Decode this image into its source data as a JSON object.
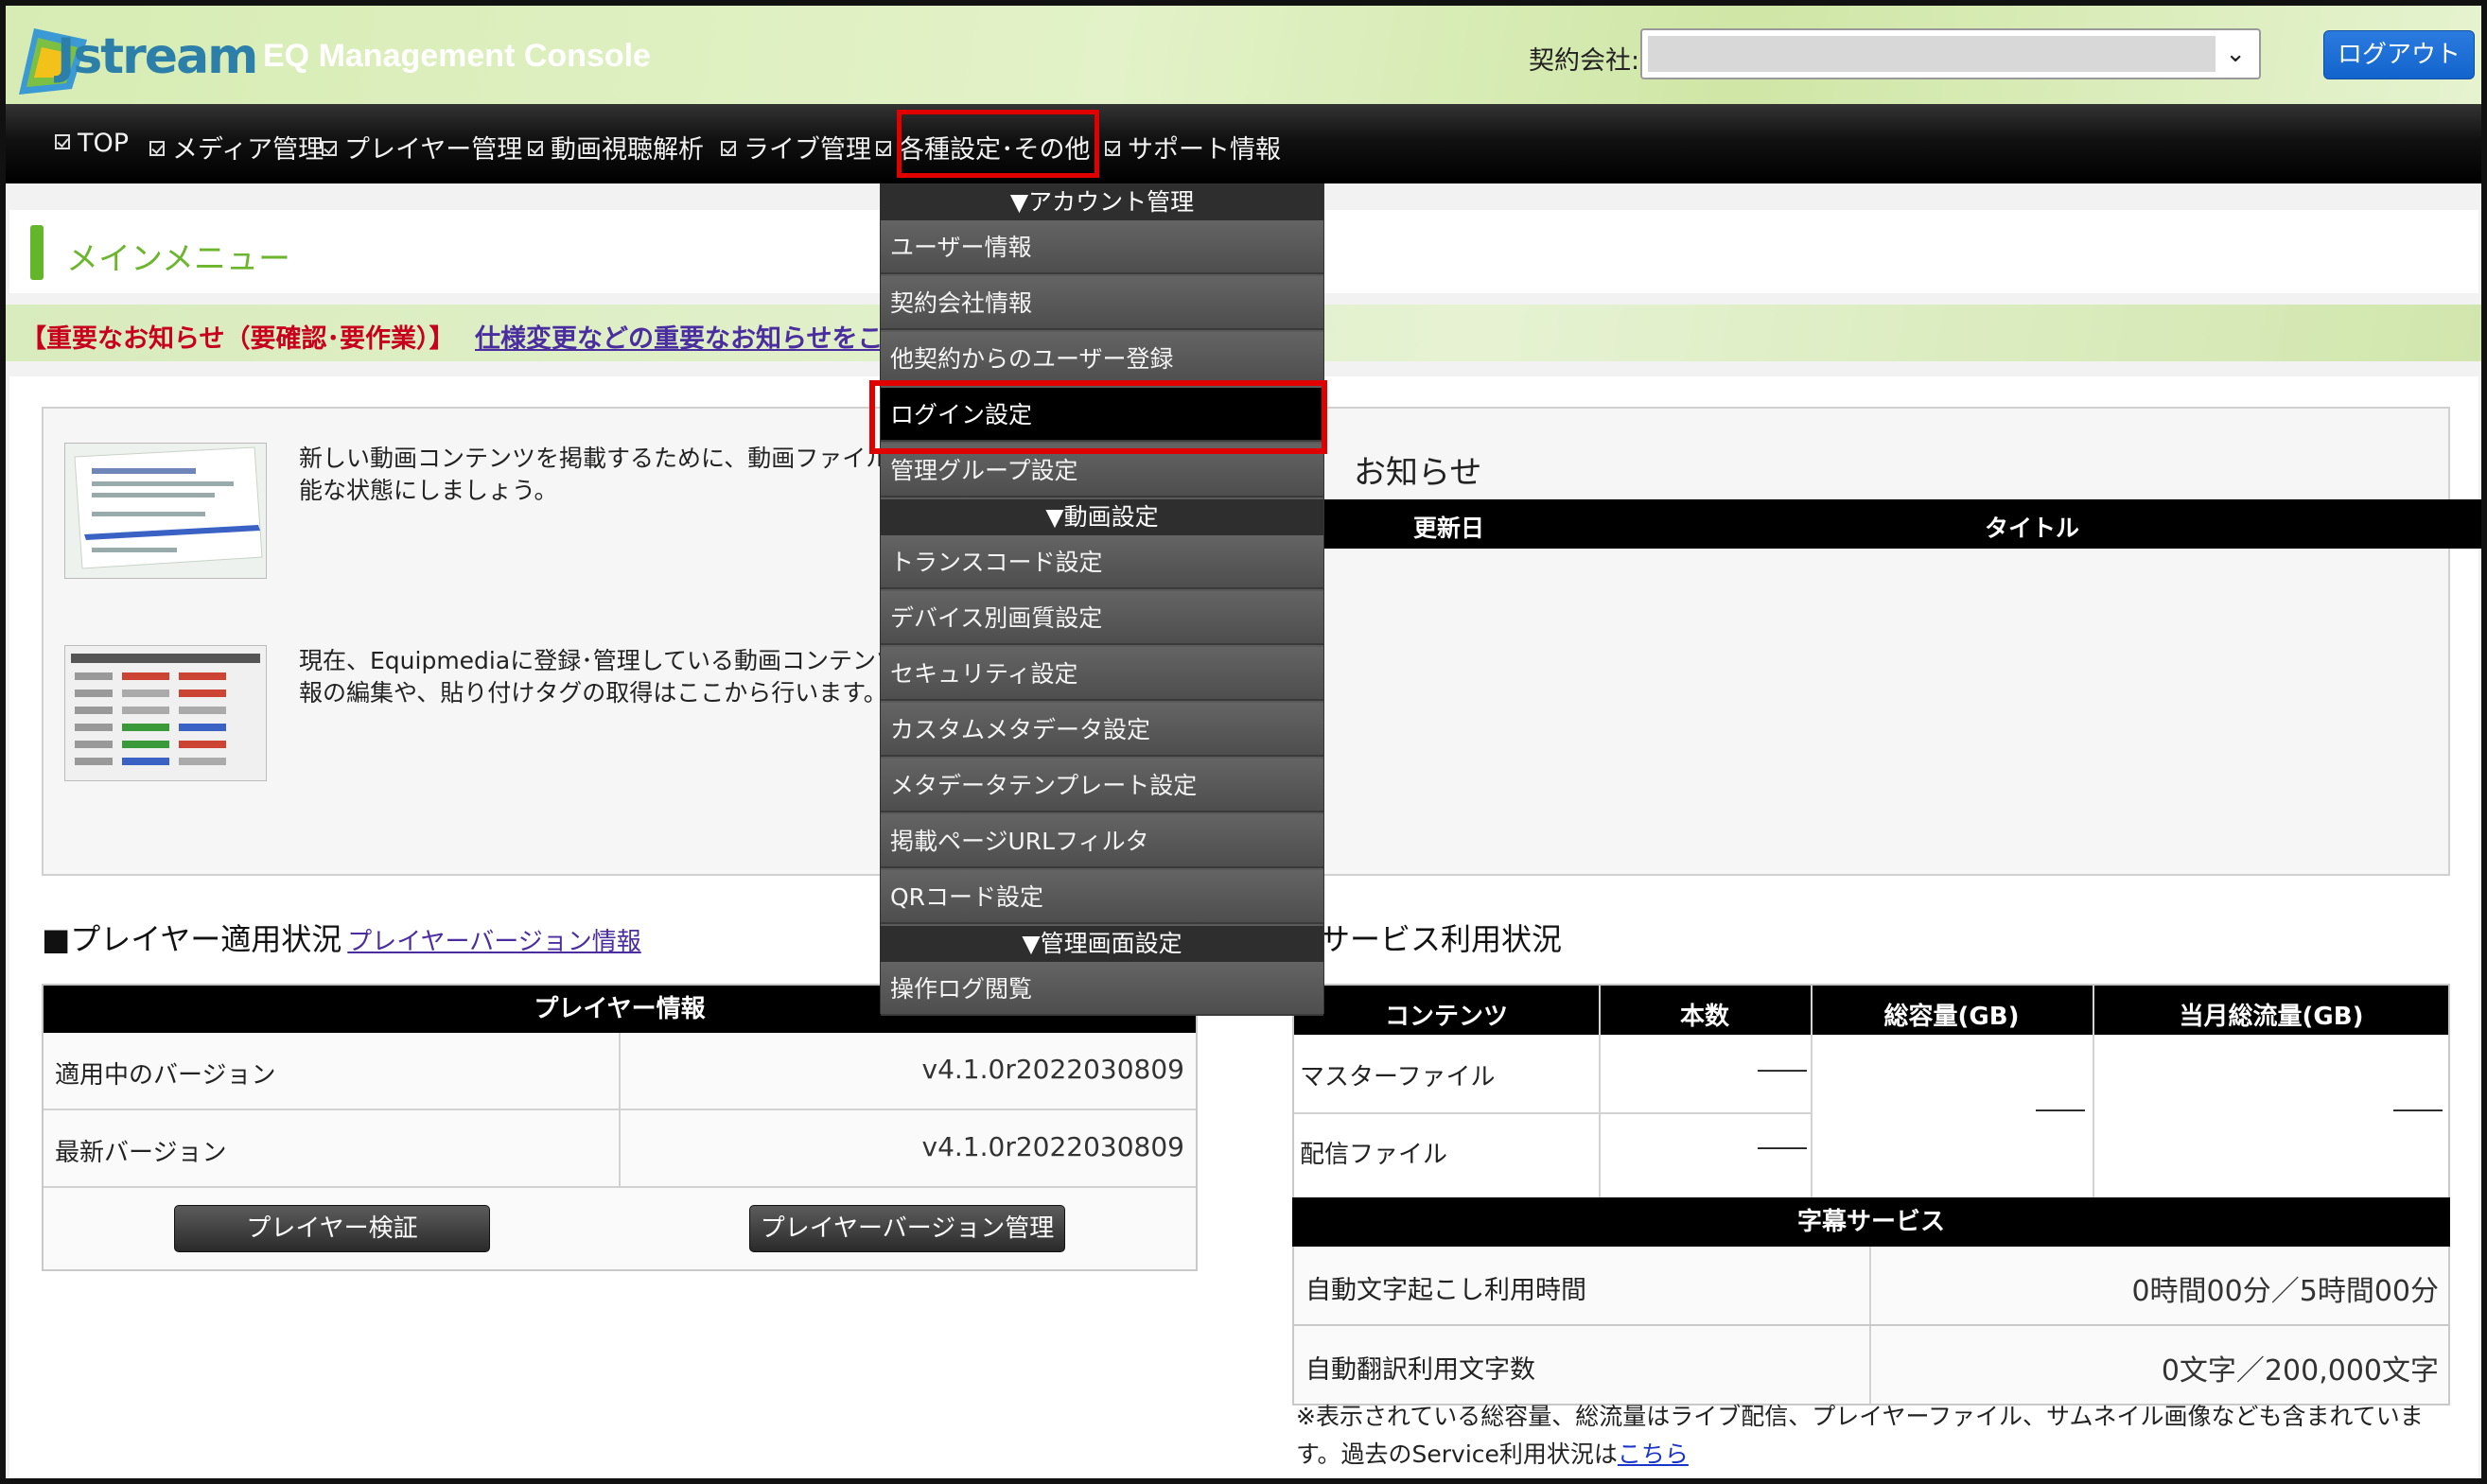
{
  "header": {
    "logo_text": "Jstream",
    "app_title": "EQ Management Console",
    "contract_label": "契約会社:",
    "contract_value": "",
    "logout_label": "ログアウト"
  },
  "nav": {
    "items": [
      {
        "label": "TOP"
      },
      {
        "label": "メディア管理"
      },
      {
        "label": "プレイヤー管理"
      },
      {
        "label": "動画視聴解析"
      },
      {
        "label": "ライブ管理"
      },
      {
        "label": "各種設定･その他"
      },
      {
        "label": "サポート情報"
      }
    ]
  },
  "main": {
    "section_title": "メインメニュー",
    "important_notice": "【重要なお知らせ（要確認･要作業）】",
    "notice_link": "仕様変更などの重要なお知らせをこ",
    "media": [
      {
        "text_line1": "新しい動画コンテンツを掲載するために、動画ファイルを",
        "text_line2": "能な状態にしましょう。"
      },
      {
        "text_line1": "現在、Equipmediaに登録･管理している動画コンテンツの",
        "text_line2": "報の編集や、貼り付けタグの取得はここから行います。"
      }
    ],
    "news": {
      "title": "お知らせ",
      "col_date": "更新日",
      "col_title": "タイトル"
    }
  },
  "player": {
    "section_title": "■プレイヤー適用状況",
    "version_link": "プレイヤーバージョン情報",
    "table_header": "プレイヤー情報",
    "rows": [
      {
        "label": "適用中のバージョン",
        "value": "v4.1.0r2022030809"
      },
      {
        "label": "最新バージョン",
        "value": "v4.1.0r2022030809"
      }
    ],
    "verify_button": "プレイヤー検証",
    "version_manage_button": "プレイヤーバージョン管理"
  },
  "service": {
    "section_title": "サービス利用状況",
    "columns": [
      "コンテンツ",
      "本数",
      "総容量(GB)",
      "当月総流量(GB)"
    ],
    "rows": [
      {
        "label": "マスターファイル",
        "count": "――"
      },
      {
        "label": "配信ファイル",
        "count": "――"
      }
    ],
    "total_capacity": "――",
    "monthly_traffic": "――",
    "subtitle_header": "字幕サービス",
    "subtitle_rows": [
      {
        "label": "自動文字起こし利用時間",
        "value": "0時間00分／5時間00分"
      },
      {
        "label": "自動翻訳利用文字数",
        "value": "0文字／200,000文字"
      }
    ],
    "footnote_line1": "※表示されている総容量、総流量はライブ配信、プレイヤーファイル、サムネイル画像なども含まれていま",
    "footnote_line2": "す。過去のService利用状況は",
    "footnote_link": "こちら"
  },
  "dropdown": {
    "account_section": "▼アカウント管理",
    "account_items": [
      "ユーザー情報",
      "契約会社情報",
      "他契約からのユーザー登録",
      "ログイン設定",
      "管理グループ設定"
    ],
    "video_section": "▼動画設定",
    "video_items": [
      "トランスコード設定",
      "デバイス別画質設定",
      "セキュリティ設定",
      "カスタムメタデータ設定",
      "メタデータテンプレート設定",
      "掲載ページURLフィルタ",
      "QRコード設定"
    ],
    "admin_section": "▼管理画面設定",
    "admin_items": [
      "操作ログ閲覧"
    ]
  },
  "colors": {
    "accent_green": "#63b52a",
    "highlight_red": "#e00000",
    "logout_blue": "#1a6fd8",
    "notice_red": "#c8001e"
  }
}
